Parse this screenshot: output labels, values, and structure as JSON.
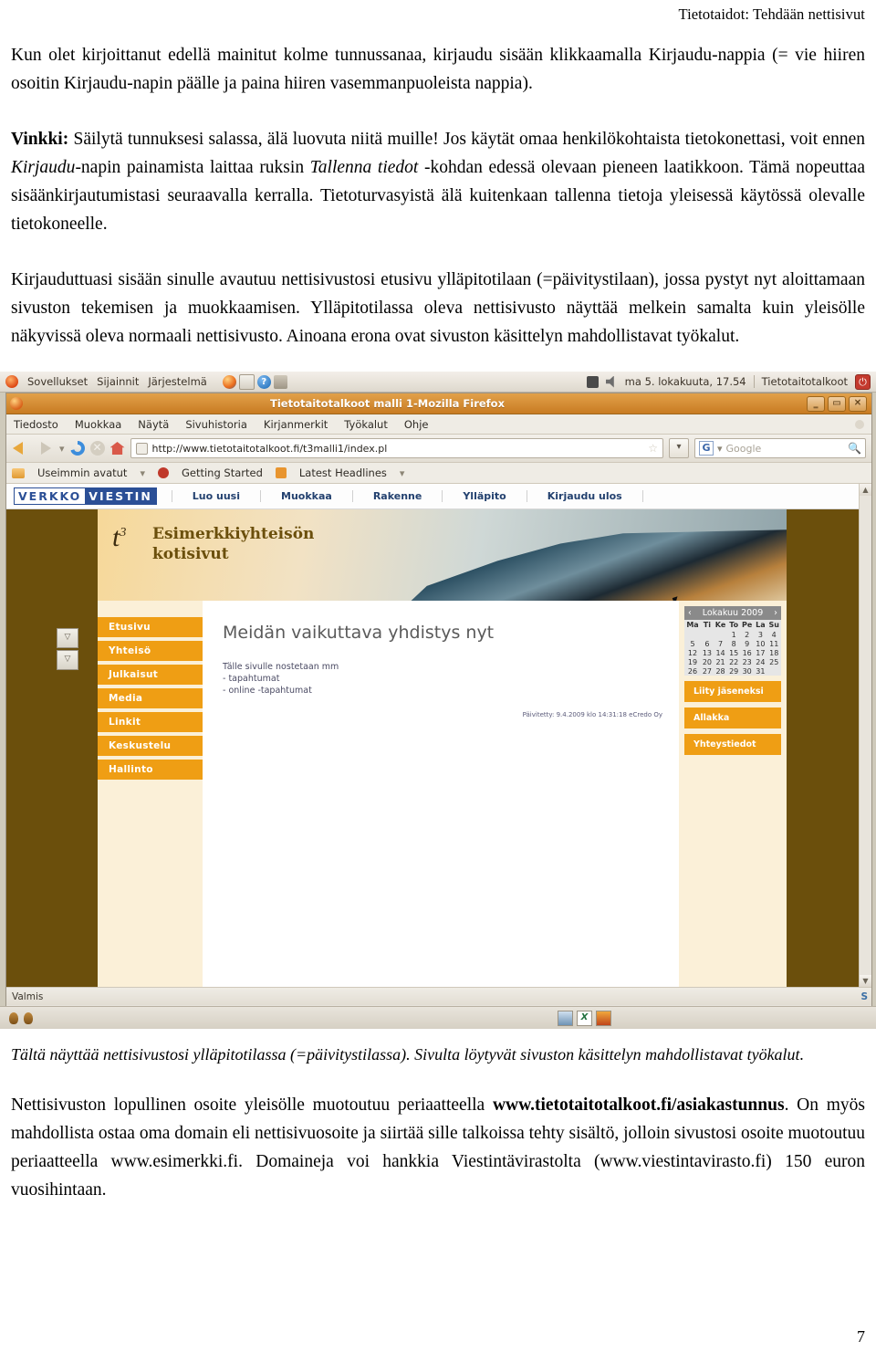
{
  "document": {
    "running_header": "Tietotaidot: Tehdään nettisivut",
    "page_number": "7",
    "paragraphs": {
      "p1": "Kun olet kirjoittanut edellä mainitut kolme tunnussanaa, kirjaudu sisään klikkaamalla Kirjaudu-nappia (= vie hiiren osoitin Kirjaudu-napin päälle ja paina hiiren vasemmanpuoleista nappia).",
      "p2_label": "Vinkki:",
      "p2_a": " Säilytä tunnuksesi salassa, älä luovuta niitä muille! Jos käytät omaa henkilökohtaista tietokonettasi, voit ennen ",
      "p2_i1": "Kirjaudu",
      "p2_b": "-napin painamista laittaa ruksin ",
      "p2_i2": "Tallenna tiedot",
      "p2_c": " -kohdan edessä olevaan pieneen laatikkoon. Tämä nopeuttaa sisäänkirjautumistasi seuraavalla kerralla. Tietoturvasyistä älä kuitenkaan tallenna tietoja yleisessä käytössä olevalle tietokoneelle.",
      "p3": "Kirjauduttuasi sisään sinulle avautuu nettisivustosi etusivu ylläpitotilaan (=päivitystilaan), jossa pystyt nyt aloittamaan sivuston tekemisen ja muokkaamisen. Ylläpitotilassa oleva nettisivusto näyttää melkein samalta kuin yleisölle näkyvissä oleva normaali nettisivusto. Ainoana erona ovat sivuston käsittelyn mahdollistavat työkalut.",
      "caption": "Tältä näyttää nettisivustosi ylläpitotilassa (=päivitystilassa). Sivulta löytyvät sivuston käsittelyn mahdollistavat työkalut.",
      "p4_a": "Nettisivuston lopullinen osoite yleisölle muotoutuu periaatteella ",
      "p4_bold": "www.tietotaitotalkoot.fi/asiakastunnus",
      "p4_b": ". On myös mahdollista ostaa oma domain eli nettisivuosoite ja siirtää sille talkoissa tehty sisältö, jolloin sivustosi osoite muotoutuu periaatteella www.esimerkki.fi. Domaineja voi hankkia Viestintävirastolta (www.viestintavirasto.fi) 150 euron vuosihintaan."
    }
  },
  "screenshot": {
    "gnome_panel": {
      "menus": [
        "Sovellukset",
        "Sijainnit",
        "Järjestelmä"
      ],
      "launcher_icons": [
        "firefox-icon",
        "mail-icon",
        "help-icon",
        "trash-icon"
      ],
      "tray_icons": [
        "display-icon",
        "volume-icon"
      ],
      "clock": "ma  5. lokakuuta, 17.54",
      "user": "Tietotaitotalkoot",
      "quit_icon": "power-icon"
    },
    "firefox": {
      "title": "Tietotaitotalkoot malli 1-Mozilla Firefox",
      "window_buttons": [
        "minimize",
        "maximize",
        "close"
      ],
      "menu": [
        "Tiedosto",
        "Muokkaa",
        "Näytä",
        "Sivuhistoria",
        "Kirjanmerkit",
        "Työkalut",
        "Ohje"
      ],
      "toolbar_icons": [
        "back-icon",
        "forward-icon",
        "history-dropdown-icon",
        "reload-icon",
        "stop-icon",
        "home-icon"
      ],
      "url": "http://www.tietotaitotalkoot.fi/t3malli1/index.pl",
      "search_engine": "G",
      "search_placeholder": "Google",
      "bookmarks": [
        "Useimmin avatut",
        "Getting Started",
        "Latest Headlines"
      ],
      "status": "Valmis"
    },
    "website": {
      "logo_part1": "VERKKO",
      "logo_part2": "VIESTIN",
      "admin_nav": [
        "Luo uusi",
        "Muokkaa",
        "Rakenne",
        "Ylläpito",
        "Kirjaudu ulos"
      ],
      "banner_mark": "t",
      "banner_sup": "3",
      "banner_title_line1": "Esimerkkiyhteisön",
      "banner_title_line2": "kotisivut",
      "left_menu": [
        "Etusivu",
        "Yhteisö",
        "Julkaisut",
        "Media",
        "Linkit",
        "Keskustelu",
        "Hallinto"
      ],
      "content_title": "Meidän vaikuttava yhdistys nyt",
      "content_lines": [
        "Tälle sivulle nostetaan mm",
        "- tapahtumat",
        "- online -tapahtumat"
      ],
      "content_stamp": "Päivitetty: 9.4.2009 klo 14:31:18 eCredo Oy",
      "calendar": {
        "prev": "‹",
        "month": "Lokakuu 2009",
        "next": "›",
        "weekdays": [
          "Ma",
          "Ti",
          "Ke",
          "To",
          "Pe",
          "La",
          "Su"
        ],
        "weeks": [
          [
            "",
            "",
            "",
            "1",
            "2",
            "3",
            "4"
          ],
          [
            "5",
            "6",
            "7",
            "8",
            "9",
            "10",
            "11"
          ],
          [
            "12",
            "13",
            "14",
            "15",
            "16",
            "17",
            "18"
          ],
          [
            "19",
            "20",
            "21",
            "22",
            "23",
            "24",
            "25"
          ],
          [
            "26",
            "27",
            "28",
            "29",
            "30",
            "31",
            ""
          ]
        ]
      },
      "right_buttons": [
        "Liity jäseneksi",
        "Allakka",
        "Yhteystiedot"
      ]
    }
  },
  "colors": {
    "ubuntu_orange": "#dd4814",
    "titlebar_orange": "#c87b22",
    "site_brown": "#6b4f0c",
    "menu_orange": "#ef9e14",
    "logo_blue": "#2b4f96"
  }
}
